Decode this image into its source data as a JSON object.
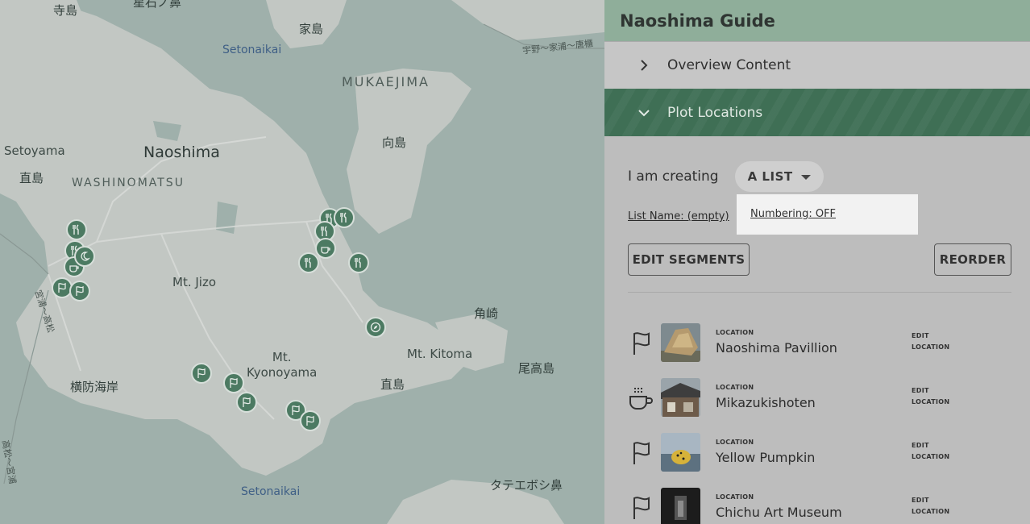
{
  "map": {
    "labels": {
      "terashima": "寺島",
      "ishigahana": "星石ノ鼻",
      "ieshima": "家島",
      "setonaikai_top": "Setonaikai",
      "uno_route": "宇野～家浦～唐櫃",
      "mukaejima": "MUKAEJIMA",
      "mukaejima_jp": "向島",
      "setoyama": "Setoyama",
      "naoshima": "Naoshima",
      "naoshima_jp_west": "直島",
      "washinomatsu": "WASHINOMATSU",
      "mt_jizo": "Mt. Jizo",
      "kakuzaki": "角崎",
      "mt_kitoma": "Mt. Kitoma",
      "mt_kyonoyama": "Mt.\nKyonoyama",
      "odakashima": "尾高島",
      "naoshima_jp_south": "直島",
      "yokobo": "横防海岸",
      "setonaikai_bottom": "Setonaikai",
      "tateeboshi": "タテエボシ鼻",
      "route_west": "高松～宮浦",
      "route_miyaura": "宮浦～高松"
    },
    "colors": {
      "land": "#c2c7c3",
      "water": "#9fb0ab",
      "marker": "#4c7a62"
    }
  },
  "panel": {
    "title": "Naoshima Guide",
    "sections": [
      {
        "label": "Overview Content",
        "state": "collapsed"
      },
      {
        "label": "Plot Locations",
        "state": "expanded"
      }
    ],
    "creating": {
      "label": "I am creating",
      "value": "A LIST"
    },
    "list_name": "List Name: (empty)",
    "numbering": "Numbering: OFF",
    "buttons": {
      "edit_segments": "EDIT SEGMENTS",
      "reorder": "REORDER"
    },
    "locations": [
      {
        "type": "LOCATION",
        "name": "Naoshima Pavillion",
        "icon": "flag-icon",
        "edit": "EDIT\nLOCATION"
      },
      {
        "type": "LOCATION",
        "name": "Mikazukishoten",
        "icon": "coffee-icon",
        "edit": "EDIT\nLOCATION"
      },
      {
        "type": "LOCATION",
        "name": "Yellow Pumpkin",
        "icon": "flag-icon",
        "edit": "EDIT\nLOCATION"
      },
      {
        "type": "LOCATION",
        "name": "Chichu Art Museum",
        "icon": "flag-icon",
        "edit": "EDIT\nLOCATION"
      }
    ],
    "colors": {
      "header": "#8fae9a",
      "active_section": "#3f6f55"
    }
  }
}
